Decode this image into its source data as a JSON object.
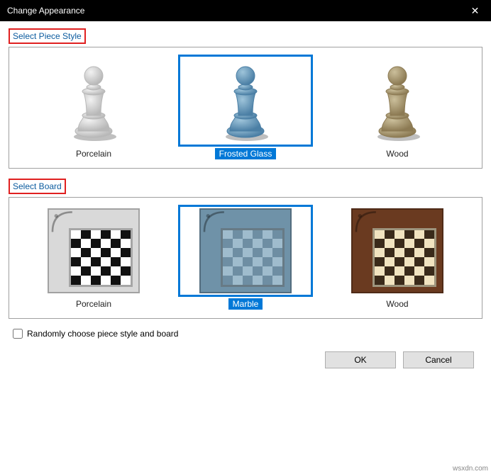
{
  "window": {
    "title": "Change Appearance",
    "close_glyph": "✕"
  },
  "piece_section": {
    "label": "Select Piece Style",
    "options": [
      {
        "label": "Porcelain",
        "selected": false,
        "light": "#f2f2f2",
        "dark": "#b8b8b8"
      },
      {
        "label": "Frosted Glass",
        "selected": true,
        "light": "#9ec4da",
        "dark": "#4b7fa5"
      },
      {
        "label": "Wood",
        "selected": false,
        "light": "#cbbf9b",
        "dark": "#8c7a53"
      }
    ]
  },
  "board_section": {
    "label": "Select Board",
    "options": [
      {
        "label": "Porcelain",
        "selected": false,
        "frame": "#d9d9d9",
        "sq1": "#ffffff",
        "sq2": "#111111"
      },
      {
        "label": "Marble",
        "selected": true,
        "frame": "#6f92a8",
        "sq1": "#9fbccd",
        "sq2": "#6e8ea3"
      },
      {
        "label": "Wood",
        "selected": false,
        "frame": "#6a3a20",
        "sq1": "#f1e3c0",
        "sq2": "#3a2a1a"
      }
    ]
  },
  "random": {
    "label": "Randomly choose piece style and board",
    "checked": false
  },
  "buttons": {
    "ok": "OK",
    "cancel": "Cancel"
  },
  "watermark": "wsxdn.com"
}
